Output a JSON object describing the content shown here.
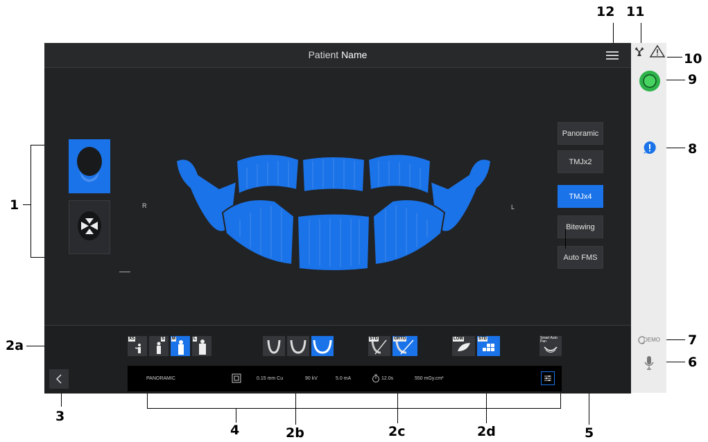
{
  "header": {
    "title_prefix": "Patient",
    "title_name": "Name"
  },
  "protocols": [
    "Panoramic",
    "TMJx2",
    "TMJx4",
    "Bitewing",
    "Auto FMS"
  ],
  "active_protocol": "TMJx4",
  "side_labels": {
    "right": "R",
    "left": "L"
  },
  "patient_sizes": [
    "XS",
    "S",
    "M",
    "L"
  ],
  "selected_patient_size": "M",
  "view_tags": [
    "STD",
    "ORTO"
  ],
  "dose_tags": [
    "LOW",
    "STD"
  ],
  "smart_auto_pan": "Smart Auto Pan",
  "status": {
    "mode": "PANORAMIC",
    "filter": "0.15 mm Cu",
    "kv": "90 kV",
    "ma": "5.0 mA",
    "time": "12.0s",
    "dose": "550 mGy.cm²"
  },
  "demo_label": "DEMO",
  "callouts": {
    "c1": "1",
    "c2a": "2a",
    "c2b": "2b",
    "c2c": "2c",
    "c2d": "2d",
    "c3": "3",
    "c4": "4",
    "c5": "5",
    "c6": "6",
    "c7": "7",
    "c8": "8",
    "c9": "9",
    "c10": "10",
    "c11": "11",
    "c12": "12"
  },
  "colors": {
    "accent": "#1a73e8",
    "bg": "#222325",
    "power": "#2db34a"
  }
}
